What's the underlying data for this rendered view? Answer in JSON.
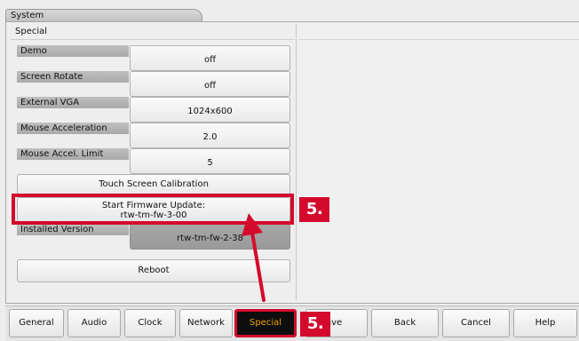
{
  "window": {
    "title": "System"
  },
  "panel": {
    "section_title": "Special"
  },
  "settings": [
    {
      "label": "Demo",
      "value": "off"
    },
    {
      "label": "Screen Rotate",
      "value": "off"
    },
    {
      "label": "External VGA",
      "value": "1024x600"
    },
    {
      "label": "Mouse Acceleration",
      "value": "2.0"
    },
    {
      "label": "Mouse Accel. Limit",
      "value": "5"
    }
  ],
  "buttons": {
    "touch_calibration": "Touch Screen Calibration",
    "firmware_update_line1": "Start Firmware Update:",
    "firmware_update_line2": "rtw-tm-fw-3-00",
    "reboot": "Reboot"
  },
  "installed": {
    "label": "Installed Version",
    "value": "rtw-tm-fw-2-38"
  },
  "annotations": {
    "step_badge": "5.",
    "accent_color": "#d30a2c"
  },
  "bottom_tabs": [
    {
      "label": "General"
    },
    {
      "label": "Audio"
    },
    {
      "label": "Clock"
    },
    {
      "label": "Network"
    },
    {
      "label": "Special",
      "active": true
    },
    {
      "label": "ave"
    },
    {
      "label": "Back"
    },
    {
      "label": "Cancel"
    },
    {
      "label": "Help"
    }
  ]
}
